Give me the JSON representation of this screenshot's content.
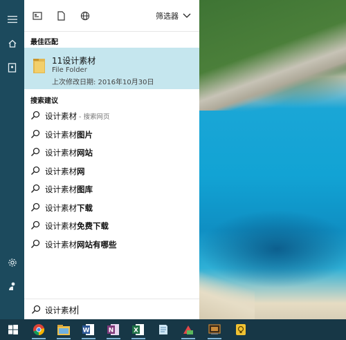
{
  "toolbar": {
    "filter_label": "筛选器"
  },
  "best_match": {
    "section_title": "最佳匹配",
    "name": "11设计素材",
    "type": "File Folder",
    "modified": "上次修改日期: 2016年10月30日"
  },
  "suggestions": {
    "section_title": "搜索建议",
    "items": [
      {
        "base": "设计素材",
        "suffix": "",
        "hint": " - 搜索网页"
      },
      {
        "base": "设计素材",
        "suffix": "图片",
        "hint": ""
      },
      {
        "base": "设计素材",
        "suffix": "网站",
        "hint": ""
      },
      {
        "base": "设计素材",
        "suffix": "网",
        "hint": ""
      },
      {
        "base": "设计素材",
        "suffix": "图库",
        "hint": ""
      },
      {
        "base": "设计素材",
        "suffix": "下载",
        "hint": ""
      },
      {
        "base": "设计素材",
        "suffix": "免费下载",
        "hint": ""
      },
      {
        "base": "设计素材",
        "suffix": "网站有哪些",
        "hint": ""
      }
    ]
  },
  "search": {
    "query": "设计素材"
  },
  "taskbar": {
    "apps": [
      "windows-start",
      "chrome",
      "file-explorer",
      "word",
      "onenote",
      "excel",
      "notepad",
      "paint",
      "media",
      "idea"
    ]
  },
  "colors": {
    "rail": "#1c4a5d",
    "highlight": "#c5e6ee",
    "taskbar": "#173746"
  }
}
